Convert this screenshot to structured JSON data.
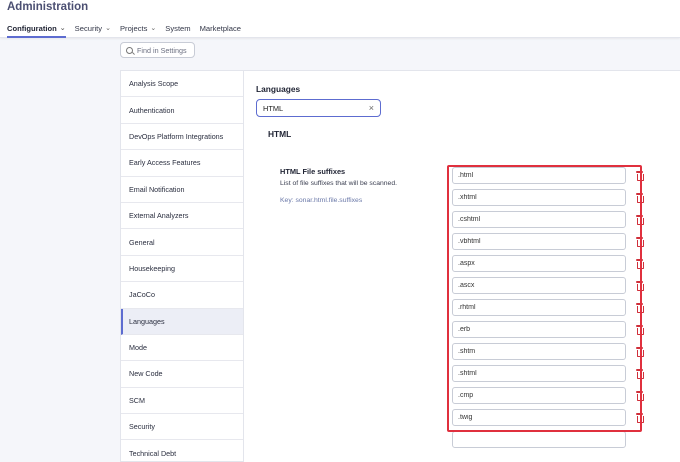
{
  "app_title": "Administration",
  "nav": [
    {
      "label": "Configuration",
      "dropdown": true,
      "active": true
    },
    {
      "label": "Security",
      "dropdown": true
    },
    {
      "label": "Projects",
      "dropdown": true
    },
    {
      "label": "System",
      "dropdown": false
    },
    {
      "label": "Marketplace",
      "dropdown": false
    }
  ],
  "search": {
    "placeholder": "Find in Settings"
  },
  "sidebar": {
    "items": [
      {
        "label": "Analysis Scope"
      },
      {
        "label": "Authentication"
      },
      {
        "label": "DevOps Platform Integrations"
      },
      {
        "label": "Early Access Features"
      },
      {
        "label": "Email Notification"
      },
      {
        "label": "External Analyzers"
      },
      {
        "label": "General"
      },
      {
        "label": "Housekeeping"
      },
      {
        "label": "JaCoCo"
      },
      {
        "label": "Languages",
        "active": true
      },
      {
        "label": "Mode"
      },
      {
        "label": "New Code"
      },
      {
        "label": "SCM"
      },
      {
        "label": "Security"
      },
      {
        "label": "Technical Debt"
      }
    ]
  },
  "content": {
    "title": "Languages",
    "language_filter": {
      "value": "HTML"
    },
    "section_title": "HTML",
    "setting": {
      "name": "HTML File suffixes",
      "description": "List of file suffixes that will be scanned.",
      "key": "Key: sonar.html.file.suffixes",
      "values": [
        ".html",
        ".xhtml",
        ".cshtml",
        ".vbhtml",
        ".aspx",
        ".ascx",
        ".rhtml",
        ".erb",
        ".shtm",
        ".shtml",
        ".cmp",
        ".twig"
      ],
      "new_value": ""
    }
  },
  "colors": {
    "accent": "#5d6cd0",
    "delete": "#d02f3a",
    "highlight": "#e0303e"
  }
}
